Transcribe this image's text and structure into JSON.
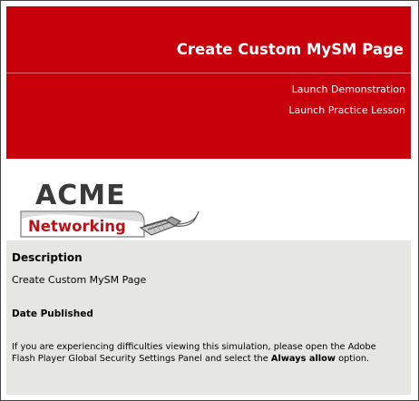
{
  "header": {
    "title": "Create Custom MySM Page",
    "links": {
      "demo": "Launch Demonstration",
      "practice": "Launch Practice Lesson"
    }
  },
  "logo": {
    "word_top": "ACME",
    "word_bottom": "Networking"
  },
  "info": {
    "description_heading": "Description",
    "description_text": "Create Custom MySM Page",
    "date_heading": "Date Published",
    "help_text_before": "If you are experiencing difficulties viewing this simulation, please open the Adobe Flash Player Global Security Settings Panel and select the ",
    "help_text_bold": "Always allow",
    "help_text_after": " option."
  },
  "colors": {
    "header_bg": "#c8000b",
    "info_bg": "#e6e6e2"
  }
}
